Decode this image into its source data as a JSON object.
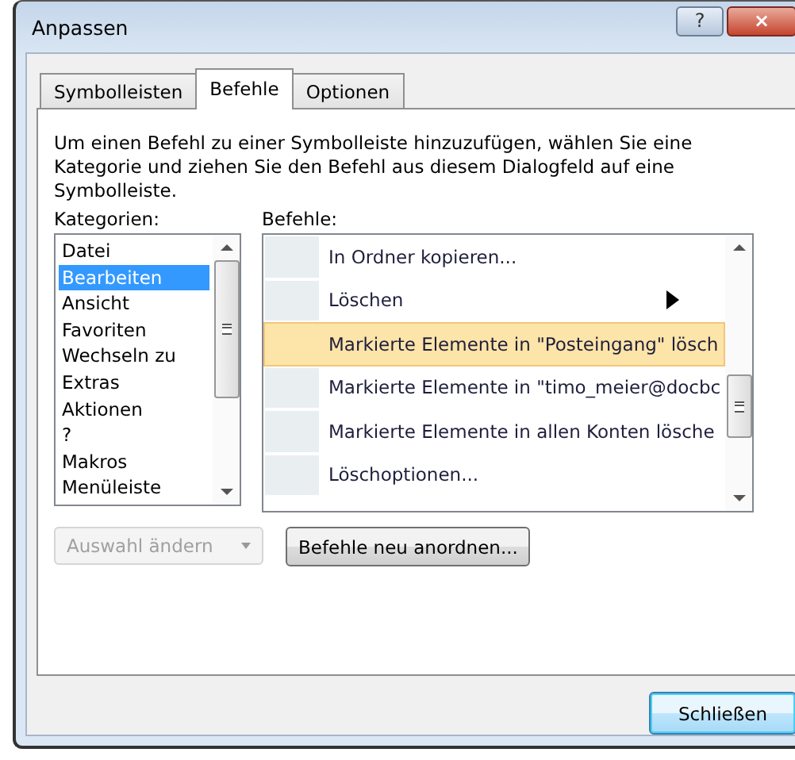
{
  "window": {
    "title": "Anpassen",
    "buttons": [
      "?",
      "×"
    ]
  },
  "tabs": [
    {
      "label": "Symbolleisten",
      "selected": false
    },
    {
      "label": "Befehle",
      "selected": true
    },
    {
      "label": "Optionen",
      "selected": false
    }
  ],
  "description": "Um einen Befehl zu einer Symbolleiste hinzuzufügen, wählen Sie eine Kategorie und ziehen Sie den Befehl aus diesem Dialogfeld auf eine Symbolleiste.",
  "categories": {
    "label": "Kategorien:",
    "items": [
      {
        "label": "Datei",
        "selected": false
      },
      {
        "label": "Bearbeiten",
        "selected": true
      },
      {
        "label": "Ansicht",
        "selected": false
      },
      {
        "label": "Favoriten",
        "selected": false
      },
      {
        "label": "Wechseln zu",
        "selected": false
      },
      {
        "label": "Extras",
        "selected": false
      },
      {
        "label": "Aktionen",
        "selected": false
      },
      {
        "label": "?",
        "selected": false
      },
      {
        "label": "Makros",
        "selected": false
      },
      {
        "label": "Menüleiste",
        "selected": false
      }
    ]
  },
  "commands": {
    "label": "Befehle:",
    "items": [
      {
        "label": "In Ordner kopieren...",
        "kind": "plain",
        "selected": false
      },
      {
        "label": "Löschen",
        "kind": "submenu",
        "selected": false
      },
      {
        "label": "Markierte Elemente in \"Posteingang\" lösch",
        "kind": "plain",
        "selected": true
      },
      {
        "label": "Markierte Elemente in \"timo_meier@docbc",
        "kind": "plain",
        "selected": false
      },
      {
        "label": "Markierte Elemente in allen Konten lösche",
        "kind": "plain",
        "selected": false
      },
      {
        "label": "Löschoptionen...",
        "kind": "plain",
        "selected": false
      }
    ]
  },
  "modify_selection": {
    "label": "Auswahl ändern",
    "disabled": true
  },
  "rearrange_button": "Befehle neu anordnen...",
  "close_button": "Schließen"
}
